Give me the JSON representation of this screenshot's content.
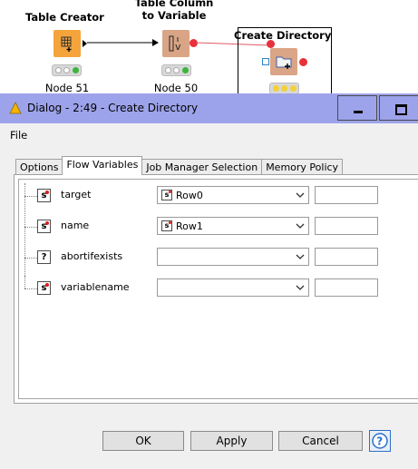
{
  "workflow": {
    "nodes": [
      {
        "title": "Table Creator",
        "label": "Node 51",
        "color": "#f5a43b"
      },
      {
        "title_line1": "Table Column",
        "title_line2": "to Variable",
        "label": "Node 50",
        "color": "#d9a586"
      },
      {
        "title": "Create Directory",
        "color": "#d9a586"
      }
    ]
  },
  "dialog": {
    "title": "Dialog - 2:49 - Create Directory",
    "menu": {
      "file": "File"
    },
    "tabs": [
      {
        "label": "Options",
        "active": false
      },
      {
        "label": "Flow Variables",
        "active": true
      },
      {
        "label": "Job Manager Selection",
        "active": false
      },
      {
        "label": "Memory Policy",
        "active": false
      }
    ],
    "rows": [
      {
        "name": "target",
        "type_icon": "s",
        "selected": "Row0",
        "selected_icon": "s"
      },
      {
        "name": "name",
        "type_icon": "s",
        "selected": "Row1",
        "selected_icon": "s"
      },
      {
        "name": "abortifexists",
        "type_icon": "?",
        "selected": "",
        "selected_icon": ""
      },
      {
        "name": "variablename",
        "type_icon": "s",
        "selected": "",
        "selected_icon": ""
      }
    ],
    "buttons": {
      "ok": "OK",
      "apply": "Apply",
      "cancel": "Cancel"
    },
    "colors": {
      "titlebar": "#9da3ea",
      "frame": "#8f93e0"
    }
  }
}
